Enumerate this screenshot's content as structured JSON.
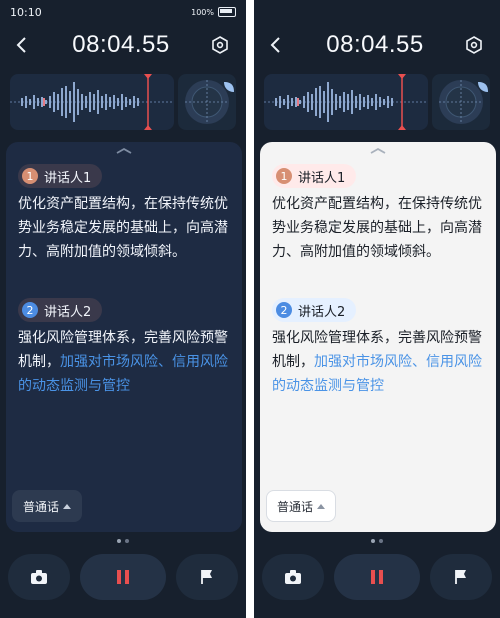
{
  "status_bar": {
    "time": "10:10",
    "battery_percent": "100%"
  },
  "recorder": {
    "elapsed": "08:04.55"
  },
  "speakers": [
    {
      "number": "1",
      "name": "讲话人1",
      "text": "优化资产配置结构，在保持传统优势业务稳定发展的基础上，向高潜力、高附加值的领域倾斜。"
    },
    {
      "number": "2",
      "name": "讲话人2",
      "text_plain": "强化风险管理体系，完善风险预警机制，",
      "text_highlight": "加强对市场风险、信用风险的动态监测与管控"
    }
  ],
  "language": {
    "selected": "普通话"
  },
  "controls": {
    "camera": "camera-icon",
    "pause": "pause-icon",
    "flag": "flag-icon"
  },
  "theme": {
    "dark_card": "#1e2b43",
    "light_card": "#f4f4f4",
    "accent_blue": "#4a93e6",
    "record_red": "#e84f4f"
  }
}
